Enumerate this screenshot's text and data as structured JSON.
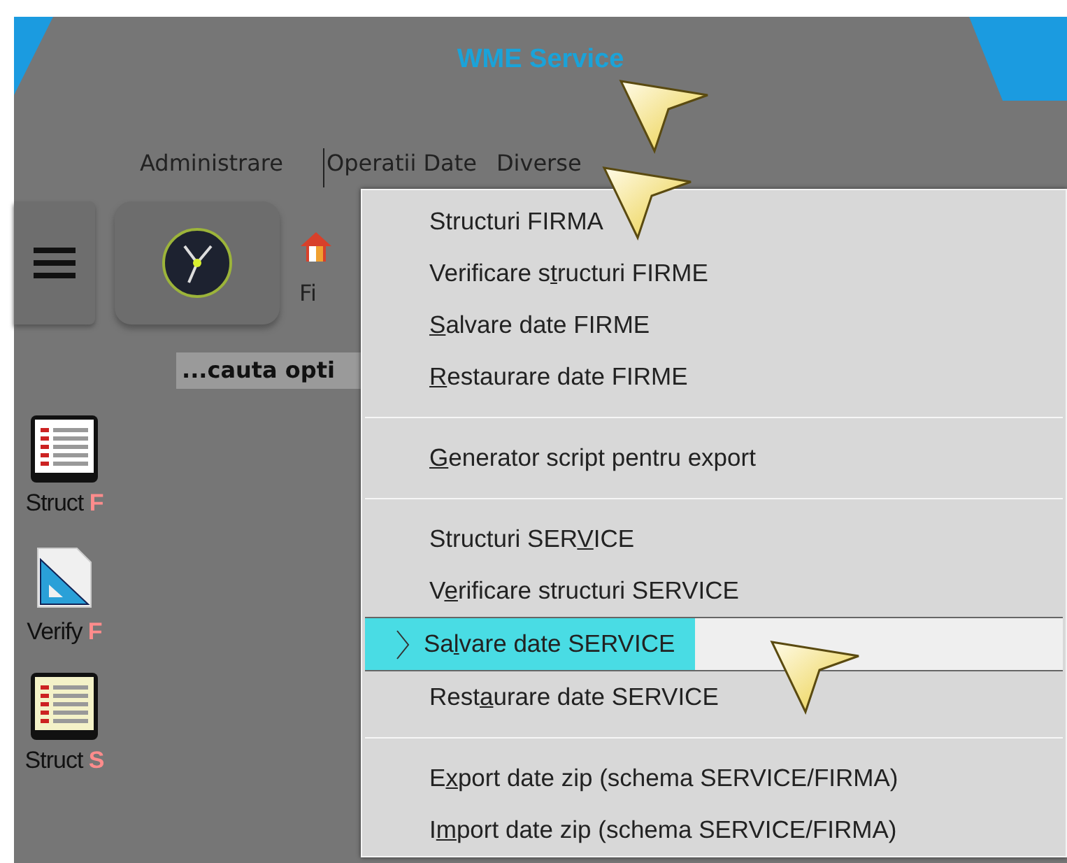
{
  "window": {
    "title": "WME Service"
  },
  "menubar": [
    {
      "label": "Administrare",
      "selected": false
    },
    {
      "label": "Operatii Date",
      "selected": true
    },
    {
      "label": "Diverse",
      "selected": false
    }
  ],
  "toolbar": {
    "item_label": "Fi"
  },
  "search": {
    "placeholder": "...cauta opti"
  },
  "shortcuts": [
    {
      "kind": "table",
      "label": "Struct ",
      "tag": "F"
    },
    {
      "kind": "verify",
      "label": "Verify ",
      "tag": "F"
    },
    {
      "kind": "table-alt",
      "label": "Struct ",
      "tag": "S"
    }
  ],
  "menu": {
    "groups": [
      [
        {
          "label": {
            "before": "Structuri FIRMA"
          },
          "selected": false
        },
        {
          "label": {
            "before": "Verificare s",
            "key": "t",
            "after": "ructuri FIRME"
          },
          "selected": false
        },
        {
          "label": {
            "key": "S",
            "after": "alvare date FIRME"
          },
          "selected": false
        },
        {
          "label": {
            "key": "R",
            "after": "estaurare date FIRME"
          },
          "selected": false
        }
      ],
      [
        {
          "label": {
            "key": "G",
            "after": "enerator script pentru export"
          },
          "selected": false
        }
      ],
      [
        {
          "label": {
            "before": "Structuri SER",
            "key": "V",
            "after": "ICE"
          },
          "selected": false
        },
        {
          "label": {
            "before": "V",
            "key": "e",
            "after": "rificare structuri SERVICE"
          },
          "selected": false
        },
        {
          "label": {
            "before": "Sa",
            "key": "l",
            "after": "vare date SERVICE"
          },
          "selected": true
        },
        {
          "label": {
            "before": "Rest",
            "key": "a",
            "after": "urare date SERVICE"
          },
          "selected": false
        }
      ],
      [
        {
          "label": {
            "before": "E",
            "key": "x",
            "after": "port date zip (schema SERVICE/FIRMA)"
          },
          "selected": false
        },
        {
          "label": {
            "before": "I",
            "key": "m",
            "after": "port date zip (schema SERVICE/FIRMA)"
          },
          "selected": false
        }
      ]
    ]
  }
}
